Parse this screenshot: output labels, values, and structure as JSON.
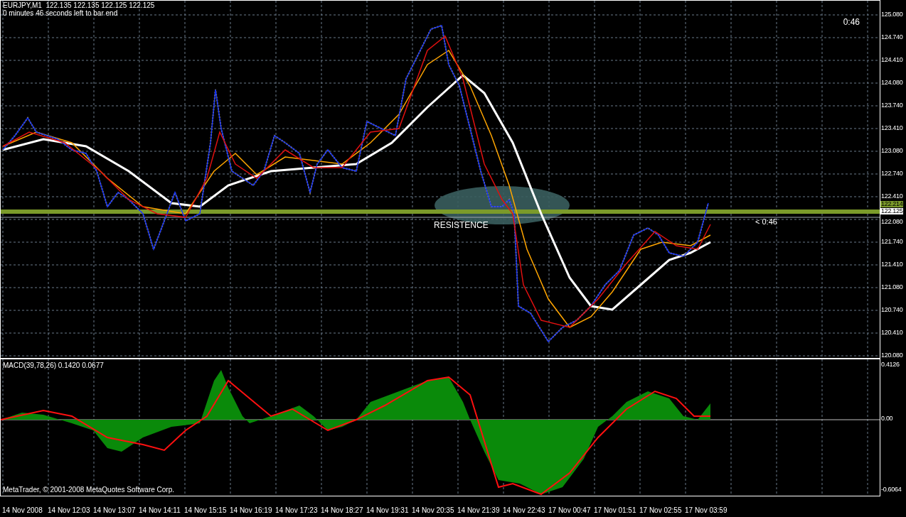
{
  "header": {
    "symbol_line": "EURJPY,M1  122.135 122.135 122.125 122.125",
    "bar_end": "0 minutes 46 seconds left to bar end",
    "timer": "0:46"
  },
  "price_axis": {
    "ticks": [
      "125.080",
      "124.740",
      "124.410",
      "124.080",
      "123.740",
      "123.410",
      "123.080",
      "122.740",
      "122.410",
      "122.080",
      "121.740",
      "121.410",
      "121.080",
      "120.740",
      "120.410",
      "120.080"
    ],
    "line_price": "122.214",
    "bid_price": "122.125"
  },
  "annotations": {
    "zone_label": "RESISTENCE",
    "countdown": "< 0:46"
  },
  "macd": {
    "title": "MACD(39,78,26) 0.1420 0.0677",
    "ticks": [
      "0.4126",
      "0.00",
      "-0.6064"
    ]
  },
  "copyright": "MetaTrader, © 2001-2008 MetaQuotes Software Corp.",
  "time_axis": [
    "14 Nov 2008",
    "14 Nov 12:03",
    "14 Nov 13:07",
    "14 Nov 14:11",
    "14 Nov 15:15",
    "14 Nov 16:19",
    "14 Nov 17:23",
    "14 Nov 18:27",
    "14 Nov 19:31",
    "14 Nov 20:35",
    "14 Nov 21:39",
    "14 Nov 22:43",
    "17 Nov 00:47",
    "17 Nov 01:51",
    "17 Nov 02:55",
    "17 Nov 03:59"
  ]
}
